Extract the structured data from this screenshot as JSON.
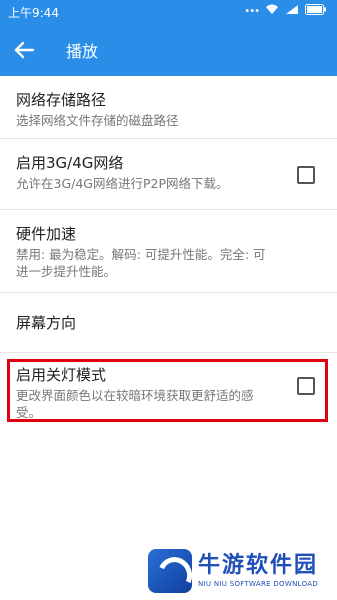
{
  "statusbar": {
    "time": "上午9:44",
    "icons": [
      "notification-dots-icon",
      "wifi-icon",
      "signal-icon",
      "battery-icon"
    ]
  },
  "appbar": {
    "title": "播放",
    "back_icon": "arrow-back-icon"
  },
  "settings": [
    {
      "title": "网络存储路径",
      "summary": "选择网络文件存储的磁盘路径",
      "checkbox": false
    },
    {
      "title": "启用3G/4G网络",
      "summary": "允许在3G/4G网络进行P2P网络下载。",
      "checkbox": true,
      "checked": false
    },
    {
      "title": "硬件加速",
      "summary": "禁用: 最为稳定。解码: 可提升性能。完全: 可进一步提升性能。",
      "checkbox": false
    },
    {
      "title": "屏幕方向",
      "summary": "",
      "checkbox": false
    },
    {
      "title": "启用关灯模式",
      "summary": "更改界面颜色以在较暗环境获取更舒适的感受。",
      "checkbox": true,
      "checked": false
    }
  ],
  "highlight_color": "#e1000f",
  "accent_color": "#2a8ee9",
  "watermark": {
    "title": "牛游软件园",
    "subtitle": "NIU NIU SOFTWARE DOWNLOAD"
  }
}
